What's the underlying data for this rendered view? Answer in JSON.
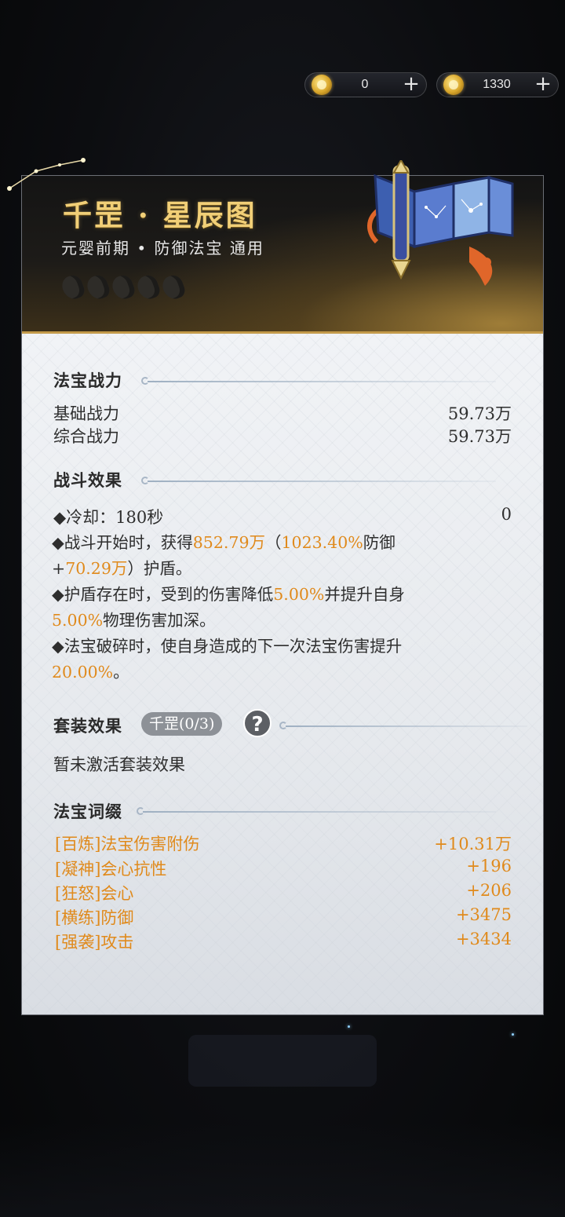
{
  "currency": [
    {
      "icon": "gold-ingot-icon",
      "value": "0",
      "plus": "+"
    },
    {
      "icon": "gold-pouch-icon",
      "value": "1330",
      "plus": "+"
    }
  ],
  "item": {
    "title": "千罡 · 星辰图",
    "subtitle": "元婴前期 • 防御法宝 通用",
    "stars_filled": 0,
    "stars_total": 5,
    "icon": "star-scroll-artifact-icon"
  },
  "power": {
    "heading": "法宝战力",
    "rows": [
      {
        "label": "基础战力",
        "value": "59.73万"
      },
      {
        "label": "综合战力",
        "value": "59.73万"
      }
    ]
  },
  "effect": {
    "heading": "战斗效果",
    "cooldown_label": "◆冷却：180秒",
    "cooldown_value": "0",
    "l1a": "◆战斗开始时，获得",
    "l1b": "852.79万",
    "l1c": "（",
    "l1d": "1023.40%",
    "l1e": "防御",
    "l2a": "+",
    "l2b": "70.29万",
    "l2c": "）护盾。",
    "l3a": "◆护盾存在时，受到的伤害降低",
    "l3b": "5.00%",
    "l3c": "并提升自身",
    "l4a": "5.00%",
    "l4b": "物理伤害加深。",
    "l5a": "◆法宝破碎时，使自身造成的下一次法宝伤害提升",
    "l6a": "20.00%",
    "l6b": "。"
  },
  "set": {
    "heading": "套装效果",
    "badge": "千罡(0/3)",
    "help": "?",
    "none_text": "暂未激活套装效果"
  },
  "affix": {
    "heading": "法宝词缀",
    "rows": [
      {
        "label": "[百炼]法宝伤害附伤",
        "value": "+10.31万"
      },
      {
        "label": "[凝神]会心抗性",
        "value": "+196"
      },
      {
        "label": "[狂怒]会心",
        "value": "+206"
      },
      {
        "label": "[横练]防御",
        "value": "+3475"
      },
      {
        "label": "[强袭]攻击",
        "value": "+3434"
      }
    ]
  },
  "colors": {
    "accent_gold": "#f1cf77",
    "highlight_orange": "#e08a1c",
    "card_bg": "#e9ecf0"
  }
}
